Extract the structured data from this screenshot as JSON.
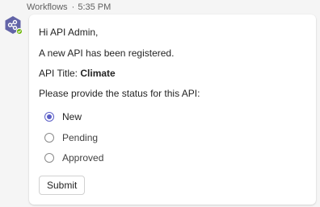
{
  "message": {
    "sender": "Workflows",
    "separator": "·",
    "time": "5:35 PM",
    "avatar_icon": "workflows-icon",
    "avatar_color": "#6264a7",
    "status_color": "#6bb700"
  },
  "card": {
    "greeting": "Hi API Admin,",
    "announcement": "A new API has been registered.",
    "api_title_label": "API Title:",
    "api_title_value": "Climate",
    "prompt": "Please provide the status for this API:",
    "options": [
      {
        "label": "New",
        "selected": true
      },
      {
        "label": "Pending",
        "selected": false
      },
      {
        "label": "Approved",
        "selected": false
      }
    ],
    "submit_label": "Submit",
    "accent_color": "#5b5fc7"
  }
}
